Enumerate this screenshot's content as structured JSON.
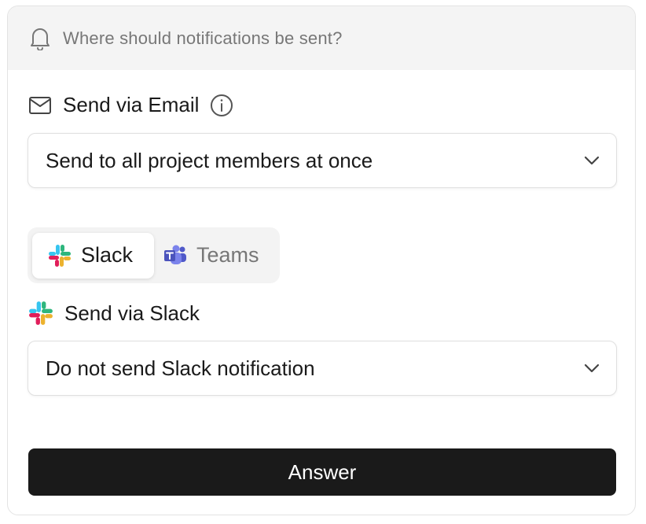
{
  "header": {
    "question": "Where should notifications be sent?",
    "icon": "bell-icon"
  },
  "email": {
    "label": "Send via Email",
    "icon": "mail-icon",
    "info_icon": "info-icon",
    "selected": "Send to all project members at once"
  },
  "channel_tabs": [
    {
      "label": "Slack",
      "icon": "slack-icon",
      "active": true
    },
    {
      "label": "Teams",
      "icon": "teams-icon",
      "active": false
    }
  ],
  "slack": {
    "label": "Send via Slack",
    "icon": "slack-icon",
    "selected": "Do not send Slack notification"
  },
  "answer_button": {
    "label": "Answer"
  },
  "colors": {
    "slack_blue": "#36C5F0",
    "slack_green": "#2EB67D",
    "slack_red": "#E01E5A",
    "slack_yellow": "#ECB22E",
    "teams_purple": "#5059C9",
    "button_bg": "#1A1A1A"
  }
}
